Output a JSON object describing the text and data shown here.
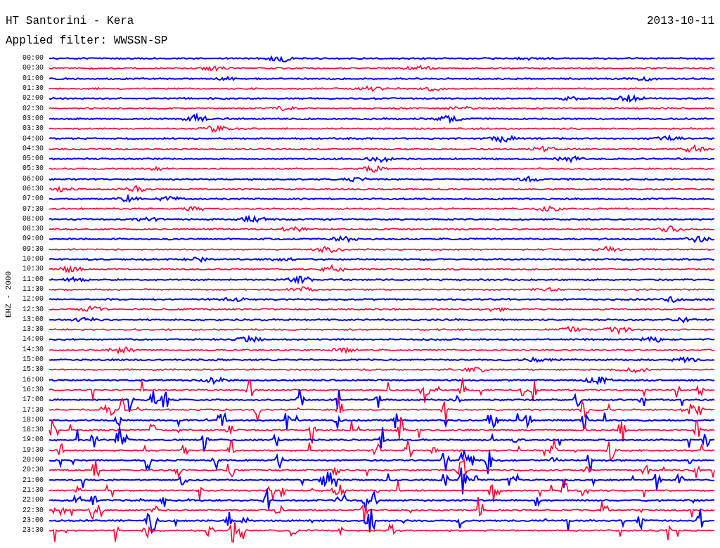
{
  "header": {
    "title": "HT Santorini - Kera",
    "date": "2013-10-11",
    "filter": "Applied filter: WWSSN-SP"
  },
  "axis_label": "EHZ - 2000",
  "traces": [
    {
      "time": "00:00",
      "color": "#0000ff"
    },
    {
      "time": "00:30",
      "color": "#ff0033"
    },
    {
      "time": "01:00",
      "color": "#0000ff"
    },
    {
      "time": "01:30",
      "color": "#ff0033"
    },
    {
      "time": "02:00",
      "color": "#0000ff"
    },
    {
      "time": "02:30",
      "color": "#ff0033"
    },
    {
      "time": "03:00",
      "color": "#0000ff"
    },
    {
      "time": "03:30",
      "color": "#ff0033"
    },
    {
      "time": "04:00",
      "color": "#0000ff"
    },
    {
      "time": "04:30",
      "color": "#ff0033"
    },
    {
      "time": "05:00",
      "color": "#0000ff"
    },
    {
      "time": "05:30",
      "color": "#ff0033"
    },
    {
      "time": "06:00",
      "color": "#0000ff"
    },
    {
      "time": "06:30",
      "color": "#ff0033"
    },
    {
      "time": "07:00",
      "color": "#0000ff"
    },
    {
      "time": "07:30",
      "color": "#ff0033"
    },
    {
      "time": "08:00",
      "color": "#0000ff"
    },
    {
      "time": "08:30",
      "color": "#ff0033"
    },
    {
      "time": "09:00",
      "color": "#0000ff"
    },
    {
      "time": "09:30",
      "color": "#ff0033"
    },
    {
      "time": "10:00",
      "color": "#0000ff"
    },
    {
      "time": "10:30",
      "color": "#ff0033"
    },
    {
      "time": "11:00",
      "color": "#0000ff"
    },
    {
      "time": "11:30",
      "color": "#ff0033"
    },
    {
      "time": "12:00",
      "color": "#0000ff"
    },
    {
      "time": "12:30",
      "color": "#ff0033"
    },
    {
      "time": "13:00",
      "color": "#0000ff"
    },
    {
      "time": "13:30",
      "color": "#ff0033"
    },
    {
      "time": "14:00",
      "color": "#0000ff"
    },
    {
      "time": "14:30",
      "color": "#ff0033"
    },
    {
      "time": "15:00",
      "color": "#0000ff"
    },
    {
      "time": "15:30",
      "color": "#ff0033"
    },
    {
      "time": "16:00",
      "color": "#0000ff"
    },
    {
      "time": "16:30",
      "color": "#ff0033"
    },
    {
      "time": "17:00",
      "color": "#0000ff"
    },
    {
      "time": "17:30",
      "color": "#ff0033"
    },
    {
      "time": "18:00",
      "color": "#0000ff"
    },
    {
      "time": "18:30",
      "color": "#ff0033"
    },
    {
      "time": "19:00",
      "color": "#0000ff"
    },
    {
      "time": "19:30",
      "color": "#ff0033"
    },
    {
      "time": "20:00",
      "color": "#0000ff"
    },
    {
      "time": "20:30",
      "color": "#ff0033"
    },
    {
      "time": "21:00",
      "color": "#0000ff"
    },
    {
      "time": "21:30",
      "color": "#ff0033"
    },
    {
      "time": "22:00",
      "color": "#0000ff"
    },
    {
      "time": "22:30",
      "color": "#ff0033"
    },
    {
      "time": "23:00",
      "color": "#0000ff"
    },
    {
      "time": "23:30",
      "color": "#ff0033"
    }
  ]
}
